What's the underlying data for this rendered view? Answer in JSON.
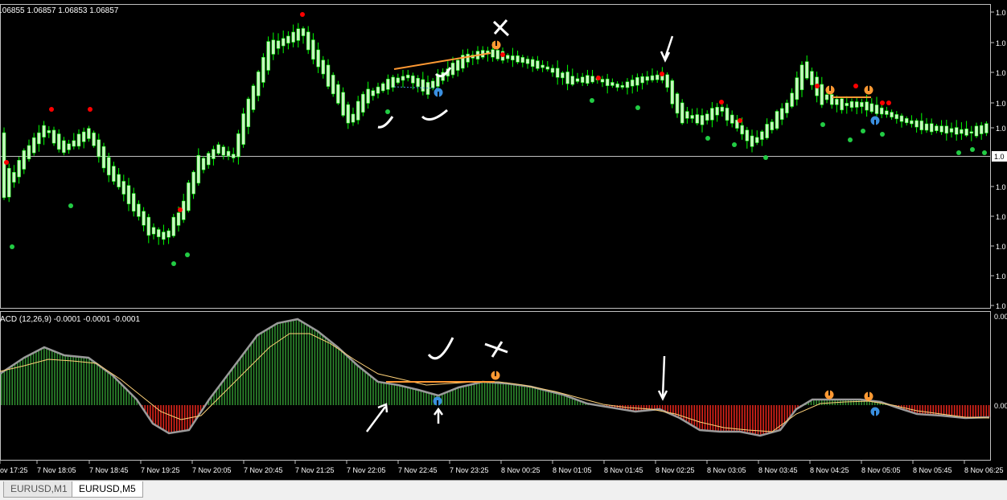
{
  "chart_data": [
    {
      "type": "candlestick",
      "symbol": "EURUSD",
      "timeframe": "M5",
      "ohlc_text": ".06855 1.06857 1.06853 1.06857",
      "price_axis_labels": [
        "0",
        "1.0",
        "1.0",
        "1.0",
        "1.0",
        "1.0",
        "1.0",
        "1.0",
        "1.0",
        "1.0",
        "1.0",
        "1.0"
      ],
      "current_price_label": "1.0",
      "candle_color_up": "#c8f5c0",
      "candle_color_down": "#c8f5c0",
      "wick_color": "#00ff00",
      "dot_red": "#ff0000",
      "dot_green": "#22cc44"
    },
    {
      "type": "macd",
      "label": "ACD (12,26,9) -0.0001 -0.0001 -0.0001",
      "axis_labels": [
        "0.00",
        "0.00"
      ],
      "hist_pos_color": "#2e8b2e",
      "hist_neg_color": "#e0241a",
      "main_line_color": "#9a9a9a",
      "signal_line_color": "#ffd27a"
    }
  ],
  "time_axis": [
    "ov 17:25",
    "7 Nov 18:05",
    "7 Nov 18:45",
    "7 Nov 19:25",
    "7 Nov 20:05",
    "7 Nov 20:45",
    "7 Nov 21:25",
    "7 Nov 22:05",
    "7 Nov 22:45",
    "7 Nov 23:25",
    "8 Nov 00:25",
    "8 Nov 01:05",
    "8 Nov 01:45",
    "8 Nov 02:25",
    "8 Nov 03:05",
    "8 Nov 03:45",
    "8 Nov 04:25",
    "8 Nov 05:05",
    "8 Nov 05:45",
    "8 Nov 06:25"
  ],
  "tabs": [
    {
      "label": "EURUSD,M1",
      "active": false
    },
    {
      "label": "EURUSD,M5",
      "active": true
    }
  ]
}
